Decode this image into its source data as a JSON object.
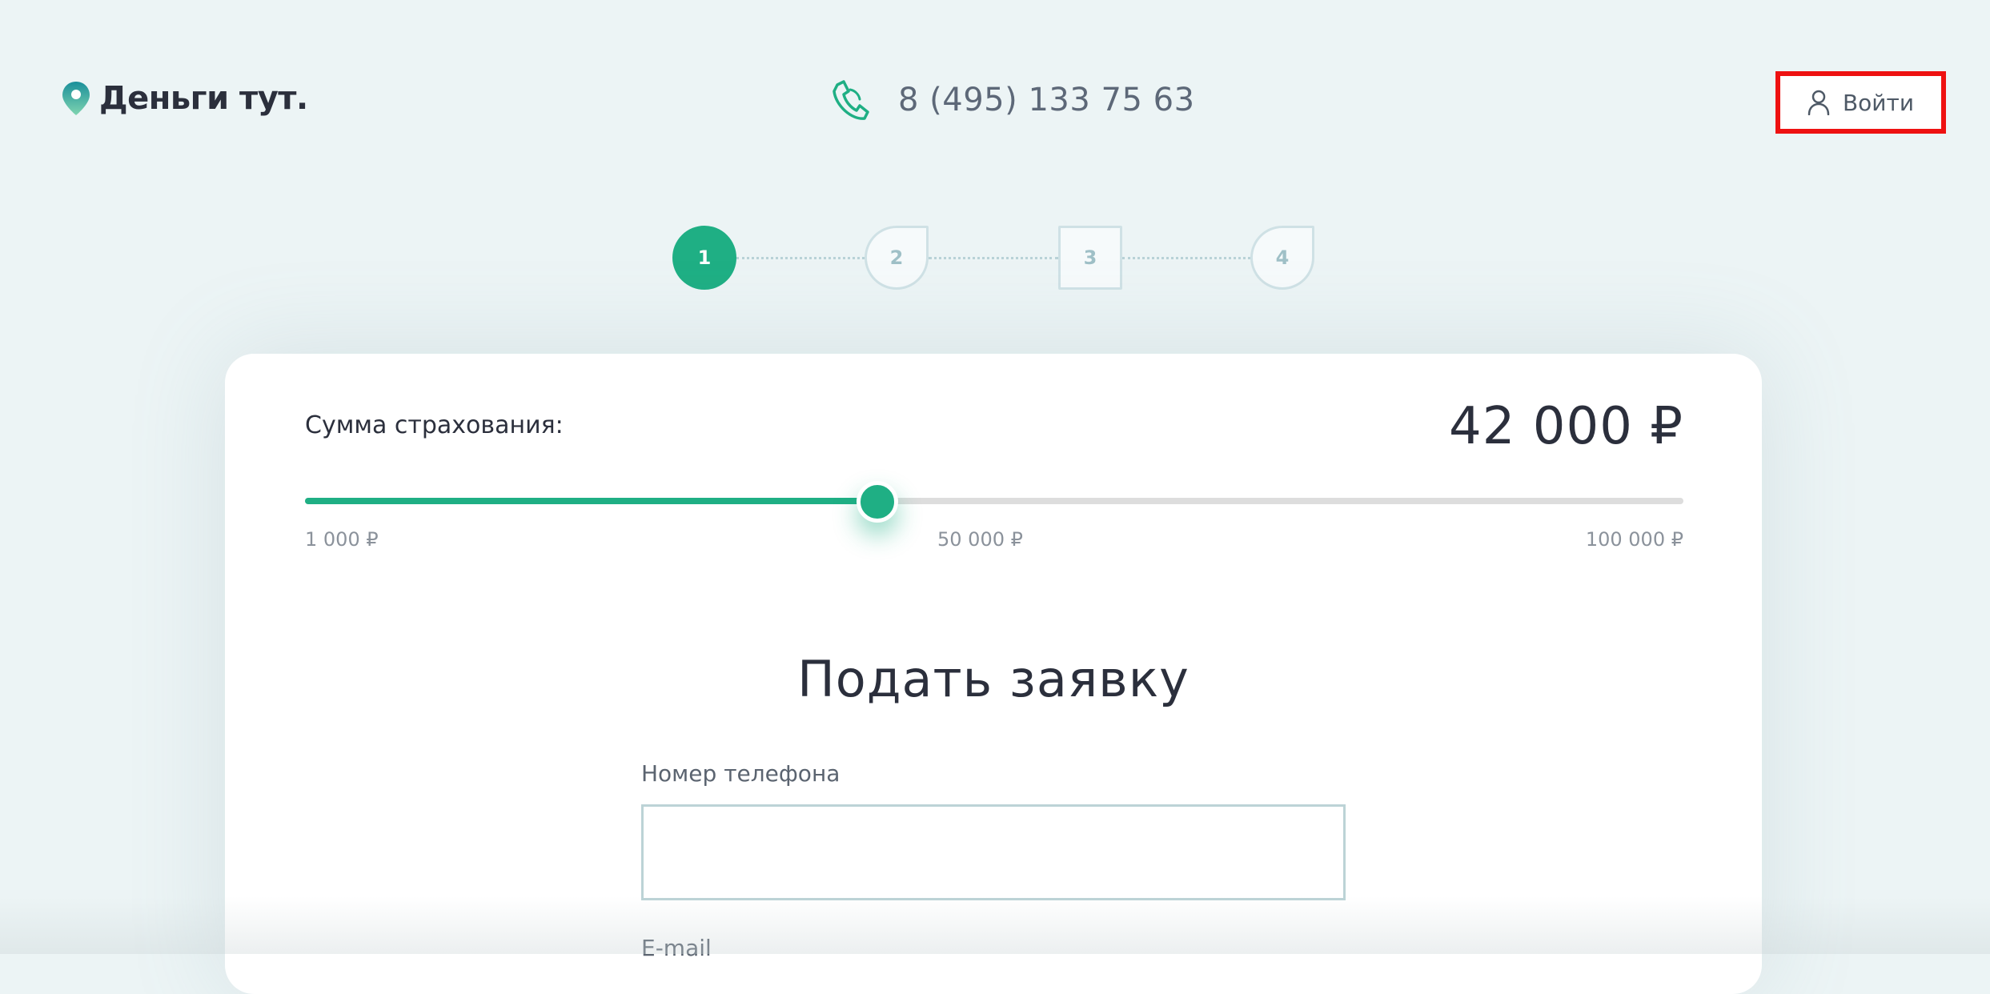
{
  "header": {
    "logo_text": "Деньги тут.",
    "phone_number": "8 (495) 133 75 63",
    "login_label": "Войти"
  },
  "steps": [
    {
      "label": "1",
      "state": "active"
    },
    {
      "label": "2",
      "state": "inactive"
    },
    {
      "label": "3",
      "state": "inactive"
    },
    {
      "label": "4",
      "state": "inactive"
    }
  ],
  "insurance": {
    "label": "Сумма страхования:",
    "value": "42 000 ₽",
    "slider": {
      "min_label": "1 000 ₽",
      "mid_label": "50 000 ₽",
      "max_label": "100 000 ₽",
      "value_fraction": 0.415
    }
  },
  "form": {
    "title": "Подать заявку",
    "phone_label": "Номер телефона",
    "phone_value": "",
    "email_label": "E-mail"
  },
  "colors": {
    "accent": "#1faf84",
    "background": "#ecf4f5",
    "highlight": "#ee1111"
  }
}
